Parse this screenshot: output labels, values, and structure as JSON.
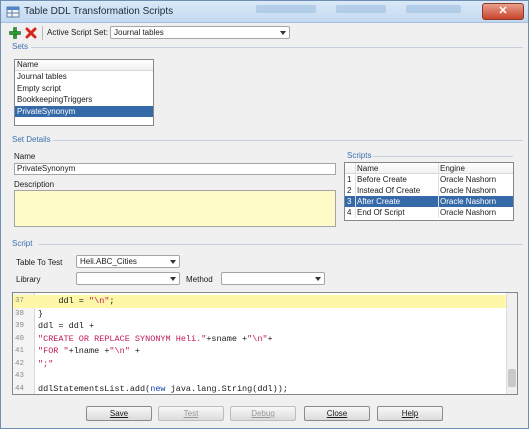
{
  "window": {
    "title": "Table DDL Transformation Scripts",
    "close_label": "✕"
  },
  "toolbar": {
    "add_icon": "plus-icon",
    "delete_icon": "x-icon",
    "active_set_label": "Active Script Set:",
    "active_set_value": "Journal tables"
  },
  "sets": {
    "section_label": "Sets",
    "column_header": "Name",
    "items": [
      {
        "label": "Journal tables",
        "selected": false
      },
      {
        "label": "Empty script",
        "selected": false
      },
      {
        "label": "BookkeepingTriggers",
        "selected": false
      },
      {
        "label": "PrivateSynonym",
        "selected": true
      }
    ]
  },
  "set_details": {
    "section_label": "Set Details",
    "name_label": "Name",
    "name_value": "PrivateSynonym",
    "description_label": "Description",
    "description_value": ""
  },
  "scripts": {
    "section_label": "Scripts",
    "columns": [
      "",
      "Name",
      "Engine"
    ],
    "rows": [
      {
        "num": "1",
        "name": "Before Create",
        "engine": "Oracle Nashorn",
        "selected": false
      },
      {
        "num": "2",
        "name": "Instead Of Create",
        "engine": "Oracle Nashorn",
        "selected": false
      },
      {
        "num": "3",
        "name": "After Create",
        "engine": "Oracle Nashorn",
        "selected": true
      },
      {
        "num": "4",
        "name": "End Of Script",
        "engine": "Oracle Nashorn",
        "selected": false
      }
    ]
  },
  "script": {
    "section_label": "Script",
    "table_to_test_label": "Table To Test",
    "table_to_test_value": "Heli.ABC_Cities",
    "library_label": "Library",
    "library_value": "",
    "method_label": "Method",
    "method_value": ""
  },
  "code": {
    "lines": [
      {
        "num": "37",
        "highlight": true,
        "parts": [
          [
            "",
            "    ddl = "
          ],
          [
            "str",
            "\"\\n\""
          ],
          [
            "",
            ";"
          ]
        ]
      },
      {
        "num": "38",
        "highlight": false,
        "parts": [
          [
            "",
            "}"
          ]
        ]
      },
      {
        "num": "39",
        "highlight": false,
        "parts": [
          [
            "",
            "ddl = ddl +"
          ]
        ]
      },
      {
        "num": "40",
        "highlight": false,
        "parts": [
          [
            "str",
            "\"CREATE OR REPLACE SYNONYM Heli.\""
          ],
          [
            "",
            "+sname +"
          ],
          [
            "str",
            "\"\\n\""
          ],
          [
            "",
            "+"
          ]
        ]
      },
      {
        "num": "41",
        "highlight": false,
        "parts": [
          [
            "str",
            "\"FOR \""
          ],
          [
            "",
            "+lname +"
          ],
          [
            "str",
            "\"\\n\""
          ],
          [
            "",
            " +"
          ]
        ]
      },
      {
        "num": "42",
        "highlight": false,
        "parts": [
          [
            "str",
            "\";\""
          ]
        ]
      },
      {
        "num": "43",
        "highlight": false,
        "parts": [
          [
            "",
            ""
          ]
        ]
      },
      {
        "num": "44",
        "highlight": false,
        "parts": [
          [
            "",
            "ddlStatementsList.add("
          ],
          [
            "kw",
            "new"
          ],
          [
            "",
            " java.lang.String(ddl));"
          ]
        ]
      }
    ]
  },
  "buttons": {
    "save": {
      "label": "Save",
      "enabled": true
    },
    "test": {
      "label": "Test",
      "enabled": false
    },
    "debug": {
      "label": "Debug",
      "enabled": false
    },
    "close": {
      "label": "Close",
      "enabled": true
    },
    "help": {
      "label": "Help",
      "enabled": true
    }
  },
  "colors": {
    "selection": "#3569a8",
    "section_label": "#3b6fb0",
    "highlight_line": "#fff7a8",
    "string_literal": "#c2185b",
    "keyword": "#1b3fb0"
  }
}
